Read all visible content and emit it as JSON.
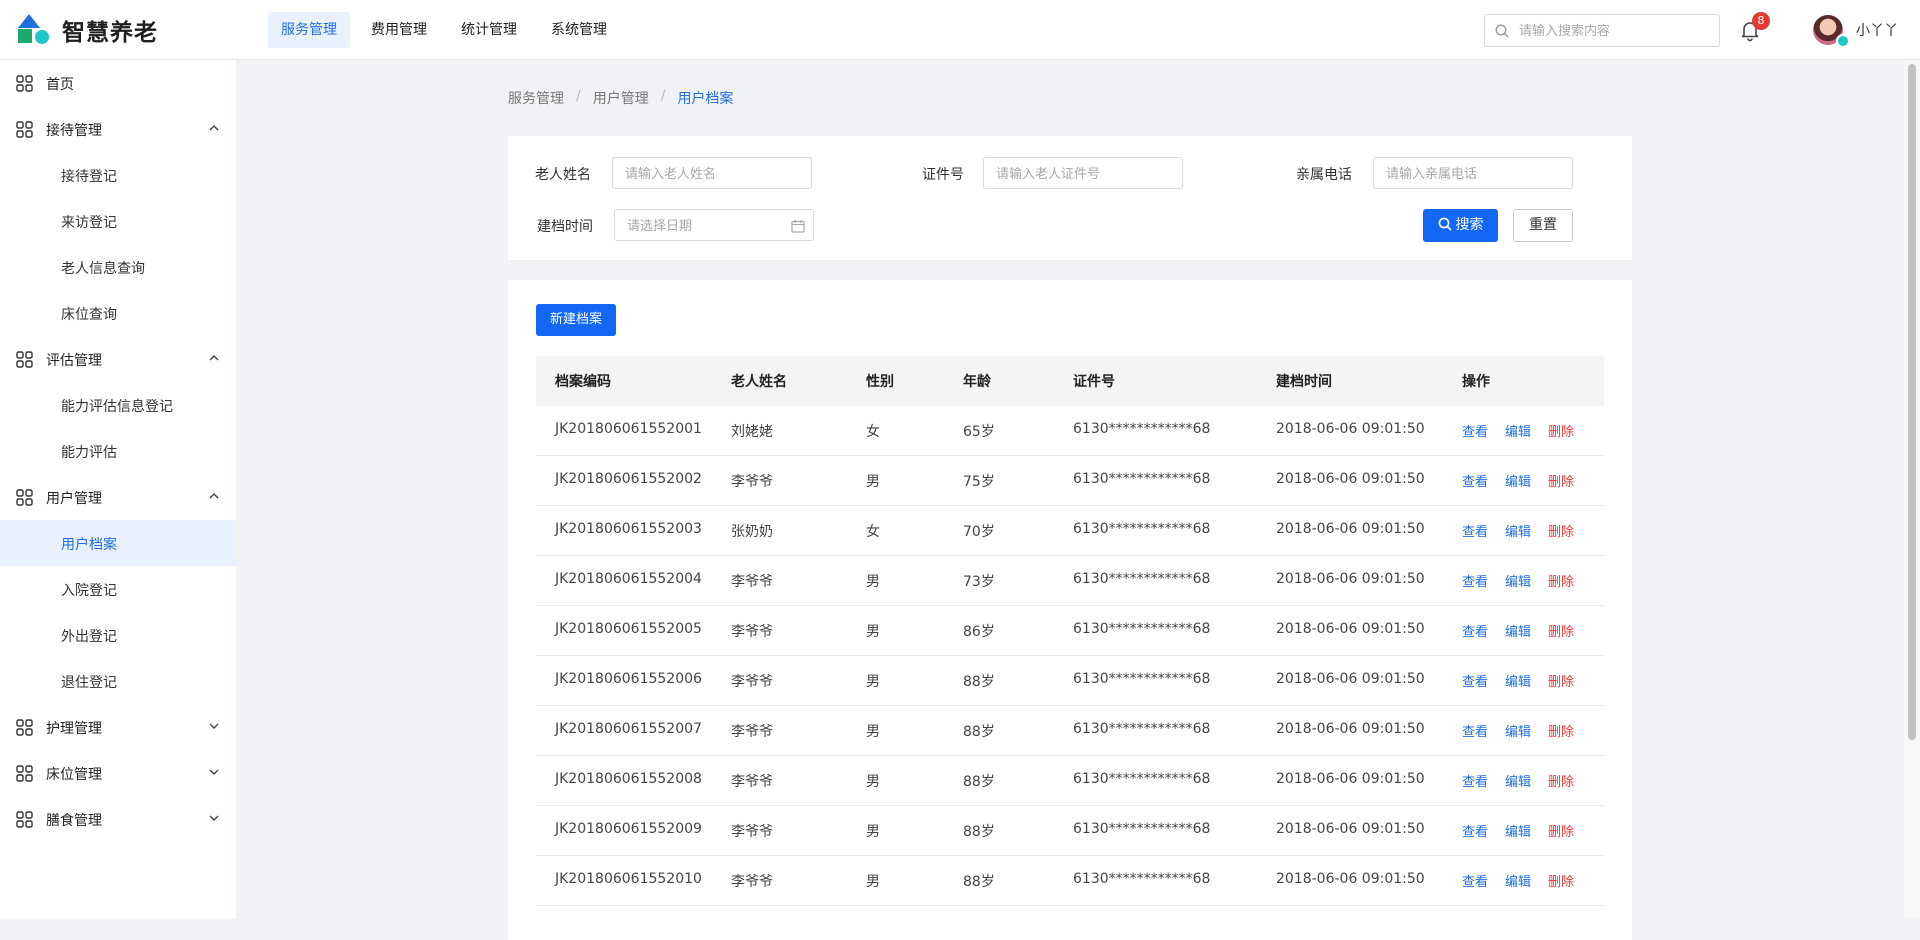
{
  "app": {
    "title": "智慧养老",
    "logo_colors": {
      "triangle": "#1f6fde",
      "square": "#1aa86b",
      "circle": "#1ec8c8"
    }
  },
  "top_nav": [
    {
      "label": "服务管理",
      "active": true
    },
    {
      "label": "费用管理",
      "active": false
    },
    {
      "label": "统计管理",
      "active": false
    },
    {
      "label": "系统管理",
      "active": false
    }
  ],
  "header": {
    "search_placeholder": "请输入搜索内容",
    "notification_count": "8",
    "username": "小丫丫"
  },
  "sidebar": {
    "home": "首页",
    "groups": [
      {
        "label": "接待管理",
        "expanded": true,
        "items": [
          "接待登记",
          "来访登记",
          "老人信息查询",
          "床位查询"
        ]
      },
      {
        "label": "评估管理",
        "expanded": true,
        "items": [
          "能力评估信息登记",
          "能力评估"
        ]
      },
      {
        "label": "用户管理",
        "expanded": true,
        "items": [
          "用户档案",
          "入院登记",
          "外出登记",
          "退住登记"
        ]
      },
      {
        "label": "护理管理",
        "expanded": false,
        "items": []
      },
      {
        "label": "床位管理",
        "expanded": false,
        "items": []
      },
      {
        "label": "膳食管理",
        "expanded": false,
        "items": []
      }
    ],
    "active_item": "用户档案"
  },
  "breadcrumb": [
    "服务管理",
    "用户管理",
    "用户档案"
  ],
  "filters": {
    "name_label": "老人姓名",
    "name_placeholder": "请输入老人姓名",
    "id_label": "证件号",
    "id_placeholder": "请输入老人证件号",
    "phone_label": "亲属电话",
    "phone_placeholder": "请输入亲属电话",
    "date_label": "建档时间",
    "date_placeholder": "请选择日期",
    "search_button": "搜索",
    "reset_button": "重置"
  },
  "table": {
    "new_button": "新建档案",
    "columns": [
      "档案编码",
      "老人姓名",
      "性别",
      "年龄",
      "证件号",
      "建档时间",
      "操作"
    ],
    "actions": {
      "view": "查看",
      "edit": "编辑",
      "delete": "删除"
    },
    "rows": [
      [
        "JK201806061552001",
        "刘姥姥",
        "女",
        "65岁",
        "6130************68",
        "2018-06-06 09:01:50"
      ],
      [
        "JK201806061552002",
        "李爷爷",
        "男",
        "75岁",
        "6130************68",
        "2018-06-06 09:01:50"
      ],
      [
        "JK201806061552003",
        "张奶奶",
        "女",
        "70岁",
        "6130************68",
        "2018-06-06 09:01:50"
      ],
      [
        "JK201806061552004",
        "李爷爷",
        "男",
        "73岁",
        "6130************68",
        "2018-06-06 09:01:50"
      ],
      [
        "JK201806061552005",
        "李爷爷",
        "男",
        "86岁",
        "6130************68",
        "2018-06-06 09:01:50"
      ],
      [
        "JK201806061552006",
        "李爷爷",
        "男",
        "88岁",
        "6130************68",
        "2018-06-06 09:01:50"
      ],
      [
        "JK201806061552007",
        "李爷爷",
        "男",
        "88岁",
        "6130************68",
        "2018-06-06 09:01:50"
      ],
      [
        "JK201806061552008",
        "李爷爷",
        "男",
        "88岁",
        "6130************68",
        "2018-06-06 09:01:50"
      ],
      [
        "JK201806061552009",
        "李爷爷",
        "男",
        "88岁",
        "6130************68",
        "2018-06-06 09:01:50"
      ],
      [
        "JK201806061552010",
        "李爷爷",
        "男",
        "88岁",
        "6130************68",
        "2018-06-06 09:01:50"
      ]
    ]
  },
  "icons": {
    "logo": "logo-icon",
    "search": "search-icon",
    "bell": "bell-icon",
    "menu": "grid-icon",
    "calendar": "calendar-icon",
    "chevron_up": "chevron-up-icon",
    "chevron_down": "chevron-down-icon"
  },
  "colors": {
    "accent": "#1267f5",
    "danger": "#e53935",
    "active_bg": "#e8f1fd"
  }
}
